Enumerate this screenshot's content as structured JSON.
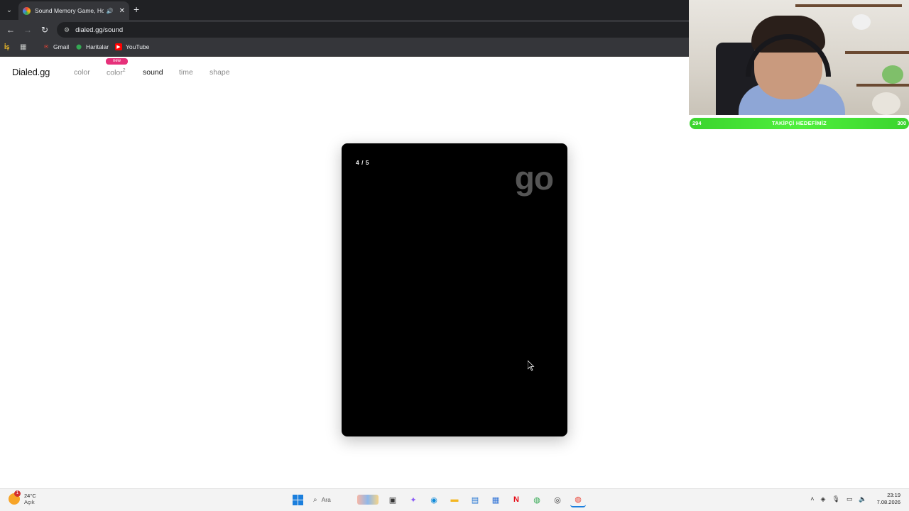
{
  "browser": {
    "tab_title": "Sound Memory Game, How",
    "url": "dialed.gg/sound",
    "bookmarks": [
      {
        "label": "Gmail",
        "icon": "gmail-icon"
      },
      {
        "label": "Haritalar",
        "icon": "maps-pin-icon"
      },
      {
        "label": "YouTube",
        "icon": "youtube-icon"
      }
    ],
    "bookmark_apps_left": "İş"
  },
  "site": {
    "logo": "Dialed.gg",
    "nav": [
      {
        "label": "color",
        "active": false
      },
      {
        "label": "color",
        "sup": "2",
        "badge": "new",
        "active": false
      },
      {
        "label": "sound",
        "active": true
      },
      {
        "label": "time",
        "active": false
      },
      {
        "label": "shape",
        "active": false
      }
    ]
  },
  "game": {
    "counter": "4 / 5",
    "prompt": "go"
  },
  "overlay": {
    "follower_current": "294",
    "follower_label": "TAKİPÇİ HEDEFİMİZ",
    "follower_goal": "300",
    "follower_progress": 0.98
  },
  "taskbar": {
    "weather_temp": "24°C",
    "weather_condition": "Açık",
    "weather_alert_count": "1",
    "search_placeholder": "Ara",
    "time": "23:19",
    "date": "7.08.2026",
    "apps": [
      "windows-start-icon",
      "search-icon",
      "task-view-icon",
      "copilot-icon",
      "edge-icon",
      "file-explorer-icon",
      "store-icon",
      "calculator-icon",
      "netflix-icon",
      "chrome-icon",
      "obs-icon",
      "chrome-icon"
    ]
  },
  "colors": {
    "accent_new_badge": "#e6317a",
    "follower_bar": "#4fef3c",
    "game_card_bg": "#000000",
    "go_text": "#555555"
  }
}
